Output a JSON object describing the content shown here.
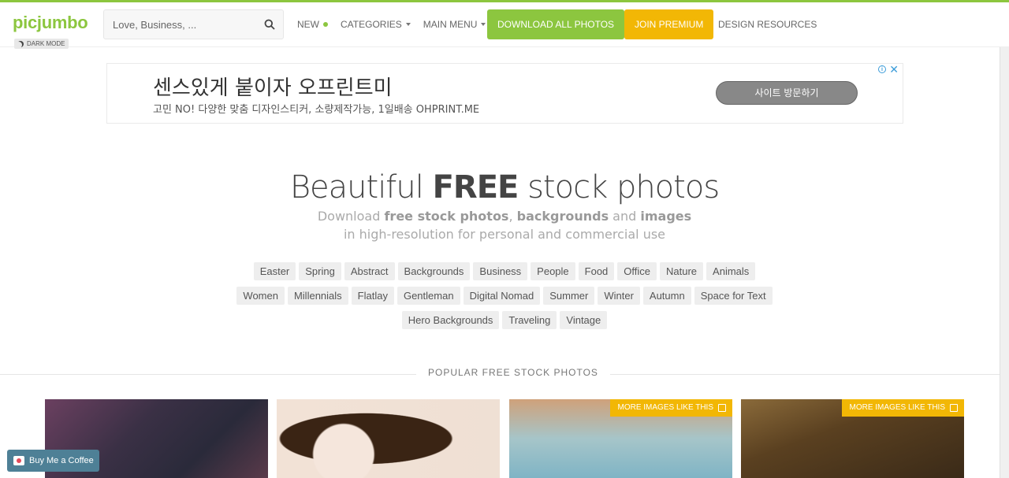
{
  "header": {
    "logo": "picjumbo",
    "dark_mode_label": "DARK MODE",
    "search_placeholder": "Love, Business, ...",
    "nav": {
      "new": "NEW",
      "categories": "CATEGORIES",
      "main_menu": "MAIN MENU"
    },
    "download_all": "DOWNLOAD ALL PHOTOS",
    "join_premium": "JOIN PREMIUM",
    "design_resources": "DESIGN RESOURCES"
  },
  "ad": {
    "title": "센스있게 붙이자 오프린트미",
    "subtitle": "고민 NO! 다양한 맞춤 디자인스티커, 소량제작가능, 1일배송 OHPRINT.ME",
    "button": "사이트 방문하기",
    "info": "i",
    "close": "✕"
  },
  "hero": {
    "title_pre": "Beautiful ",
    "title_bold": "FREE",
    "title_post": " stock photos",
    "sub_1": "Download ",
    "sub_b1": "free stock photos",
    "sub_2": ", ",
    "sub_b2": "backgrounds",
    "sub_3": " and ",
    "sub_b3": "images",
    "sub_line2": "in high-resolution for personal and commercial use"
  },
  "tags": [
    "Easter",
    "Spring",
    "Abstract",
    "Backgrounds",
    "Business",
    "People",
    "Food",
    "Office",
    "Nature",
    "Animals",
    "Women",
    "Millennials",
    "Flatlay",
    "Gentleman",
    "Digital Nomad",
    "Summer",
    "Winter",
    "Autumn",
    "Space for Text",
    "Hero Backgrounds",
    "Traveling",
    "Vintage"
  ],
  "popular_heading": "POPULAR FREE STOCK PHOTOS",
  "cards": {
    "more_label": "MORE IMAGES LIKE THIS"
  },
  "coffee_button": "Buy Me a Coffee",
  "colors": {
    "brand_green": "#8cc63f",
    "premium_yellow": "#f2b705"
  }
}
